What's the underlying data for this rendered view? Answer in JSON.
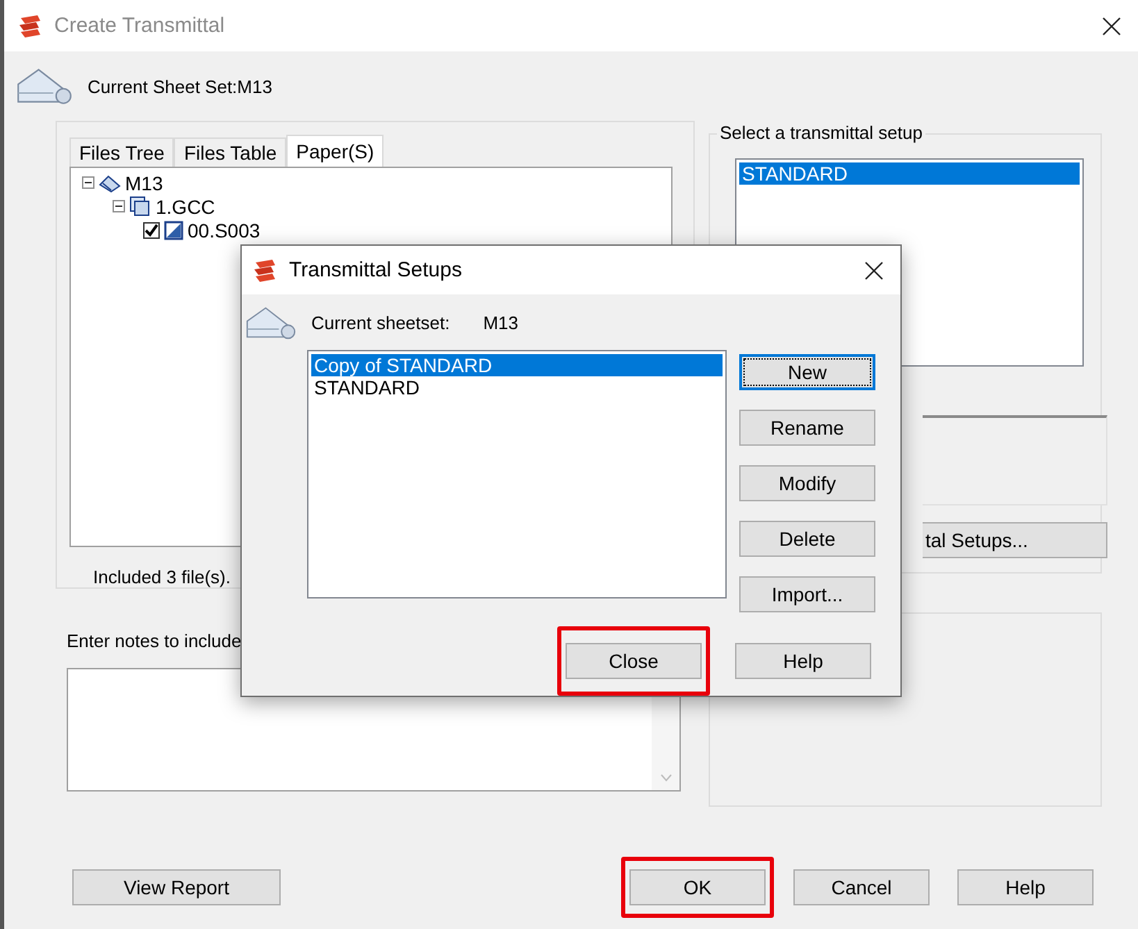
{
  "window": {
    "title": "Create Transmittal",
    "active": false
  },
  "sheet_set_label": "Current Sheet Set:M13",
  "tabs": [
    {
      "label": "Files Tree",
      "selected": false
    },
    {
      "label": "Files Table",
      "selected": false
    },
    {
      "label": "Paper(S)",
      "selected": true
    }
  ],
  "tree": [
    {
      "label": "M13",
      "kind": "sheetset",
      "expanded": true,
      "children": [
        {
          "label": "1.GCC",
          "kind": "subset",
          "expanded": true,
          "children": [
            {
              "label": "00.S003",
              "kind": "sheet",
              "checked": true
            }
          ]
        }
      ]
    }
  ],
  "included_text": "Included 3 file(s).",
  "notes_label": "Enter notes to include",
  "setup_group": {
    "title": "Select a transmittal setup",
    "items": [
      {
        "label": "STANDARD",
        "selected": true
      }
    ],
    "setups_button": "tal Setups..."
  },
  "report_button": {
    "label": "View Report",
    "highlighted": false
  },
  "dialog_buttons": [
    {
      "label": "OK",
      "highlighted": true
    },
    {
      "label": "Cancel",
      "highlighted": false
    },
    {
      "label": "Help",
      "highlighted": false
    }
  ],
  "modal": {
    "title": "Transmittal Setups",
    "sheetset_label": "Current sheetset:",
    "sheetset_value": "M13",
    "items": [
      {
        "label": "Copy of STANDARD",
        "selected": true
      },
      {
        "label": "STANDARD",
        "selected": false
      }
    ],
    "side_buttons": [
      {
        "label": "New",
        "focused": true
      },
      {
        "label": "Rename",
        "focused": false
      },
      {
        "label": "Modify",
        "focused": false
      },
      {
        "label": "Delete",
        "focused": false
      },
      {
        "label": "Import...",
        "focused": false
      }
    ],
    "bottom_buttons": [
      {
        "label": "Close",
        "highlighted": true
      },
      {
        "label": "Help",
        "highlighted": false
      }
    ]
  }
}
